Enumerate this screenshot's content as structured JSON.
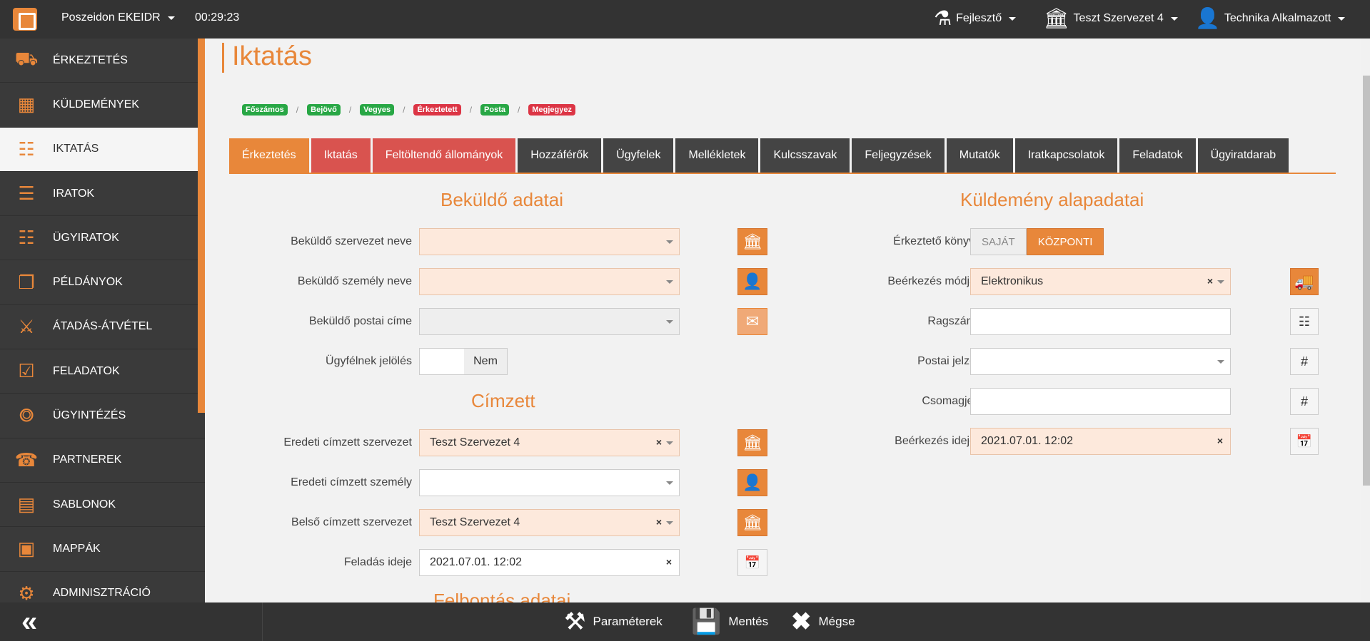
{
  "topbar": {
    "app_name": "Poszeidon EKEIDR",
    "timer": "00:29:23",
    "role": "Fejlesztő",
    "org": "Teszt Szervezet 4",
    "user": "Technika Alkalmazott"
  },
  "sidebar": {
    "items": [
      {
        "label": "ÉRKEZTETÉS",
        "icon": "trolley-icon"
      },
      {
        "label": "KÜLDEMÉNYEK",
        "icon": "package-icon"
      },
      {
        "label": "IKTATÁS",
        "icon": "book-icon"
      },
      {
        "label": "IRATOK",
        "icon": "documents-icon"
      },
      {
        "label": "ÜGYIRATOK",
        "icon": "file-stack-icon"
      },
      {
        "label": "PÉLDÁNYOK",
        "icon": "copies-icon"
      },
      {
        "label": "ÁTADÁS-ÁTVÉTEL",
        "icon": "handover-icon"
      },
      {
        "label": "FELADATOK",
        "icon": "clipboard-icon"
      },
      {
        "label": "ÜGYINTÉZÉS",
        "icon": "workflow-icon"
      },
      {
        "label": "PARTNEREK",
        "icon": "contacts-icon"
      },
      {
        "label": "SABLONOK",
        "icon": "template-icon"
      },
      {
        "label": "MAPPÁK",
        "icon": "folder-icon"
      },
      {
        "label": "ADMINISZTRÁCIÓ",
        "icon": "gear-icon"
      }
    ],
    "active_index": 2
  },
  "page": {
    "title": "Iktatás"
  },
  "breadcrumbs": [
    {
      "label": "Főszámos",
      "color": "#28a745"
    },
    {
      "label": "Bejövő",
      "color": "#28a745"
    },
    {
      "label": "Vegyes",
      "color": "#28a745"
    },
    {
      "label": "Érkeztetett",
      "color": "#dc3545"
    },
    {
      "label": "Posta",
      "color": "#28a745"
    },
    {
      "label": "Megjegyez",
      "color": "#dc3545"
    }
  ],
  "tabs": [
    {
      "label": "Érkeztetés",
      "color": "#e8873a"
    },
    {
      "label": "Iktatás",
      "color": "#d9534f"
    },
    {
      "label": "Feltöltendő állományok",
      "color": "#d9534f"
    },
    {
      "label": "Hozzáférők",
      "color": "#444444"
    },
    {
      "label": "Ügyfelek",
      "color": "#444444"
    },
    {
      "label": "Mellékletek",
      "color": "#444444"
    },
    {
      "label": "Kulcsszavak",
      "color": "#444444"
    },
    {
      "label": "Feljegyzések",
      "color": "#444444"
    },
    {
      "label": "Mutatók",
      "color": "#444444"
    },
    {
      "label": "Iratkapcsolatok",
      "color": "#444444"
    },
    {
      "label": "Feladatok",
      "color": "#444444"
    },
    {
      "label": "Ügyiratdarab",
      "color": "#444444"
    }
  ],
  "sender": {
    "title": "Beküldő adatai",
    "org_label": "Beküldő szervezet neve",
    "org_value": "",
    "person_label": "Beküldő személy neve",
    "person_value": "",
    "address_label": "Beküldő postai címe",
    "address_value": "",
    "client_label": "Ügyfélnek jelölés",
    "client_value": "Nem"
  },
  "recipient": {
    "title": "Címzett",
    "orig_org_label": "Eredeti címzett szervezet",
    "orig_org_value": "Teszt Szervezet 4",
    "orig_person_label": "Eredeti címzett személy",
    "orig_person_value": "",
    "internal_org_label": "Belső címzett szervezet",
    "internal_org_value": "Teszt Szervezet 4",
    "sent_label": "Feladás ideje",
    "sent_value": "2021.07.01. 12:02"
  },
  "next_section": {
    "title": "Felbontás adatai"
  },
  "shipment": {
    "title": "Küldemény alapadatai",
    "book_label": "Érkeztető könyv",
    "book_options": [
      "SAJÁT",
      "KÖZPONTI"
    ],
    "book_selected": "KÖZPONTI",
    "method_label": "Beérkezés módja",
    "method_value": "Elektronikus",
    "ragszam_label": "Ragszám",
    "ragszam_value": "",
    "postal_label": "Postai jelző",
    "postal_value": "",
    "csomag_label": "Csomagjel",
    "csomag_value": "",
    "arrival_label": "Beérkezés ideje",
    "arrival_value": "2021.07.01. 12:02"
  },
  "bottombar": {
    "params": "Paraméterek",
    "save": "Mentés",
    "cancel": "Mégse"
  }
}
